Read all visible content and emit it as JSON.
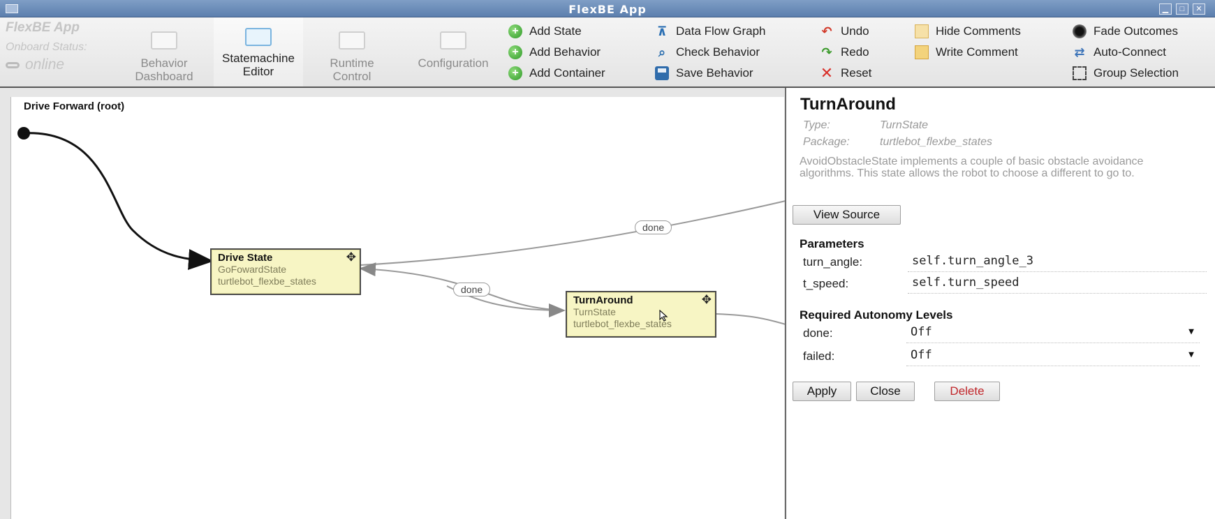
{
  "window": {
    "title": "FlexBE App"
  },
  "brand": {
    "app_name": "FlexBE App",
    "status_label": "Onboard Status:",
    "status_value": "online"
  },
  "nav": {
    "tabs": [
      {
        "label_line1": "Behavior",
        "label_line2": "Dashboard"
      },
      {
        "label_line1": "Statemachine",
        "label_line2": "Editor"
      },
      {
        "label_line1": "Runtime",
        "label_line2": "Control"
      },
      {
        "label_line1": "Configuration",
        "label_line2": ""
      }
    ]
  },
  "toolbar": {
    "add_state": "Add State",
    "add_behavior": "Add Behavior",
    "add_container": "Add Container",
    "data_flow_graph": "Data Flow Graph",
    "check_behavior": "Check Behavior",
    "save_behavior": "Save Behavior",
    "undo": "Undo",
    "redo": "Redo",
    "reset": "Reset",
    "hide_comments": "Hide Comments",
    "write_comment": "Write Comment",
    "fade_outcomes": "Fade Outcomes",
    "auto_connect": "Auto-Connect",
    "group_selection": "Group Selection"
  },
  "canvas": {
    "title": "Drive Forward (root)",
    "states": [
      {
        "name": "Drive State",
        "class": "GoFowardState",
        "package": "turtlebot_flexbe_states"
      },
      {
        "name": "TurnAround",
        "class": "TurnState",
        "package": "turtlebot_flexbe_states"
      }
    ],
    "edge_labels": [
      "done",
      "done"
    ]
  },
  "panel": {
    "title": "TurnAround",
    "type_label": "Type:",
    "type_value": "TurnState",
    "package_label": "Package:",
    "package_value": "turtlebot_flexbe_states",
    "description": "AvoidObstacleState implements a couple of basic obstacle avoidance algorithms. This state allows the robot to choose a different to go to.",
    "view_source": "View Source",
    "parameters_heading": "Parameters",
    "params": [
      {
        "label": "turn_angle:",
        "value": "self.turn_angle_3"
      },
      {
        "label": "t_speed:",
        "value": "self.turn_speed"
      }
    ],
    "autonomy_heading": "Required Autonomy Levels",
    "autonomy": [
      {
        "label": "done:",
        "value": "Off"
      },
      {
        "label": "failed:",
        "value": "Off"
      }
    ],
    "apply": "Apply",
    "close": "Close",
    "delete": "Delete"
  }
}
